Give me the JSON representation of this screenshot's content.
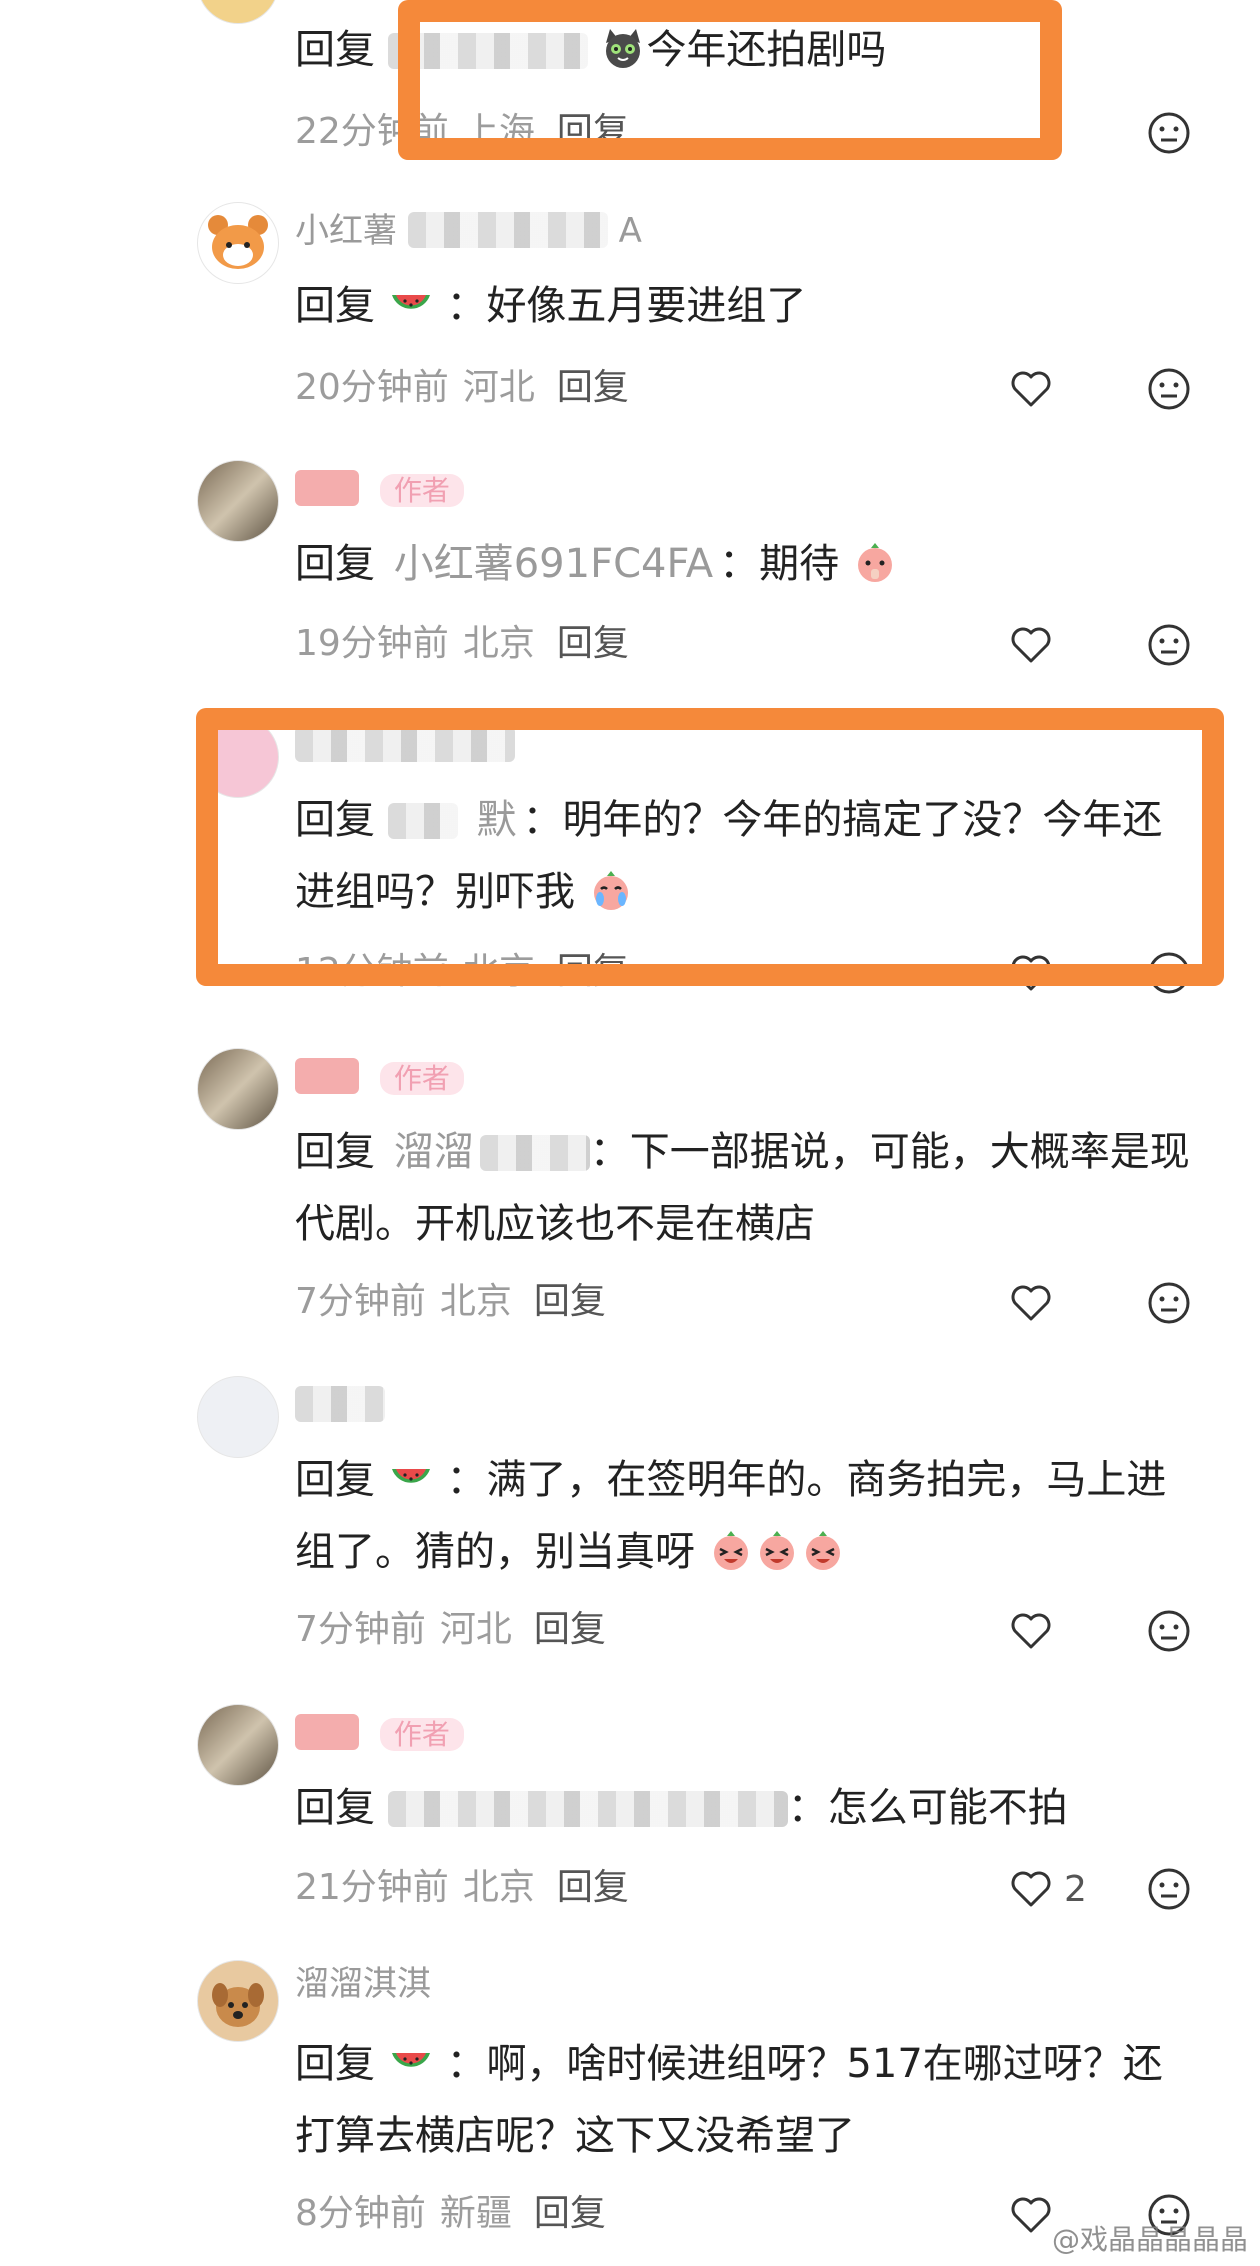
{
  "comments": [
    {
      "id": "c0",
      "reply_word": "回复",
      "reply_target": "",
      "text": "今年还拍剧吗",
      "time": "22分钟前",
      "location": "上海",
      "reply_label": "回复",
      "likes": ""
    },
    {
      "id": "c1",
      "name": "小红薯",
      "name_tail": "A",
      "reply_word": "回复",
      "text": "好像五月要进组了",
      "time": "20分钟前",
      "location": "河北",
      "reply_label": "回复",
      "likes": ""
    },
    {
      "id": "c2",
      "author_tag": "作者",
      "reply_word": "回复",
      "reply_target": "小红薯691FC4FA",
      "text": "期待",
      "time": "19分钟前",
      "location": "北京",
      "reply_label": "回复",
      "likes": ""
    },
    {
      "id": "c3",
      "reply_word": "回复",
      "reply_target": "默",
      "text": "明年的？今年的搞定了没？今年还进组吗？别吓我",
      "time": "12分钟前",
      "location": "北京",
      "reply_label": "回复",
      "likes": ""
    },
    {
      "id": "c4",
      "author_tag": "作者",
      "reply_word": "回复",
      "reply_target": "溜溜",
      "text": "下一部据说，可能，大概率是现代剧。开机应该也不是在横店",
      "time": "7分钟前",
      "location": "北京",
      "reply_label": "回复",
      "likes": ""
    },
    {
      "id": "c5",
      "reply_word": "回复",
      "text": "满了，在签明年的。商务拍完，马上进组了。猜的，别当真呀",
      "time": "7分钟前",
      "location": "河北",
      "reply_label": "回复",
      "likes": ""
    },
    {
      "id": "c6",
      "author_tag": "作者",
      "reply_word": "回复",
      "text": "怎么可能不拍",
      "time": "21分钟前",
      "location": "北京",
      "reply_label": "回复",
      "likes": "2"
    },
    {
      "id": "c7",
      "name": "溜溜淇淇",
      "reply_word": "回复",
      "text": "啊，啥时候进组呀？517在哪过呀？还打算去横店呢？这下又没希望了",
      "time": "8分钟前",
      "location": "新疆",
      "reply_label": "回复",
      "likes": ""
    }
  ],
  "watermark": "@戏晶晶晶晶晶",
  "colors": {
    "highlight": "#f5893a",
    "author_tag_bg": "#fde4ea",
    "meta": "#9c9c9c"
  },
  "icons": {
    "like": "heart-outline-icon",
    "dislike": "meh-face-icon"
  }
}
